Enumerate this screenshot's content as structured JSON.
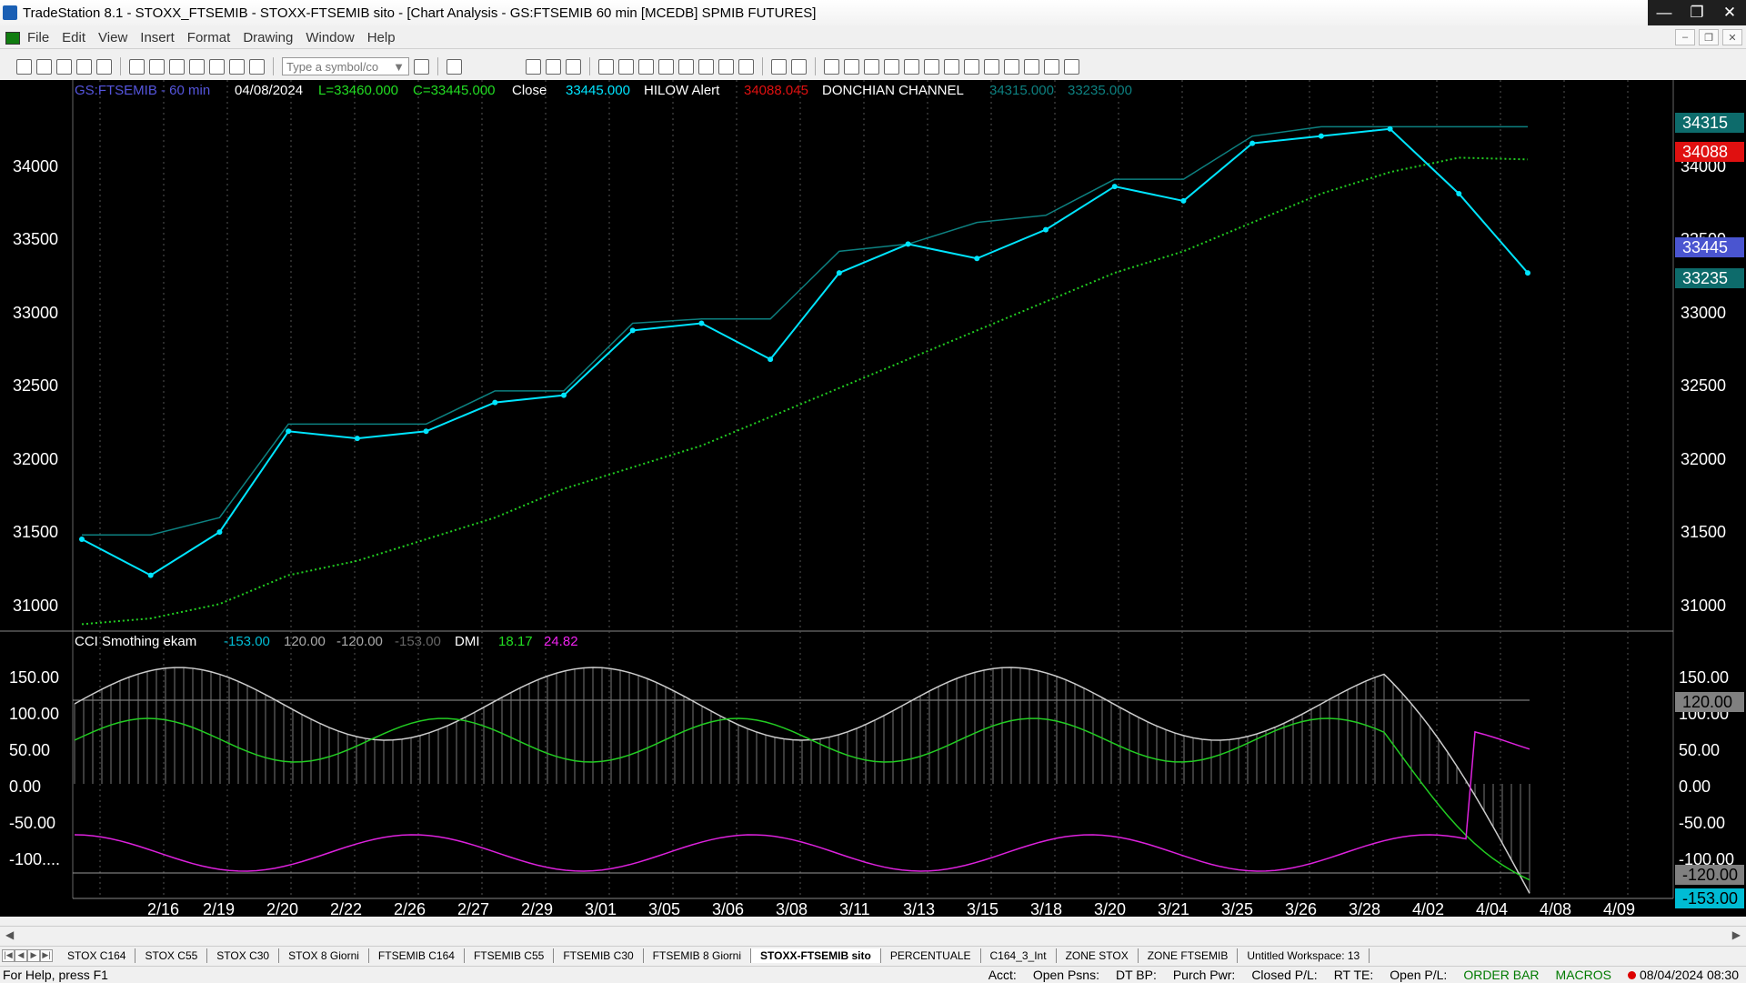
{
  "window": {
    "title": "TradeStation 8.1 - STOXX_FTSEMIB - STOXX-FTSEMIB sito - [Chart Analysis - GS:FTSEMIB  60 min  [MCEDB] SPMIB FUTURES]"
  },
  "menu": {
    "items": [
      "File",
      "Edit",
      "View",
      "Insert",
      "Format",
      "Drawing",
      "Window",
      "Help"
    ]
  },
  "toolbar": {
    "symbol_placeholder": "Type a symbol/co"
  },
  "chart": {
    "header": {
      "symbol": "GS:FTSEMIB - 60 min",
      "date": "04/08/2024",
      "low": "L=33460.000",
      "close_eq": "C=33445.000",
      "close_label": "Close",
      "close_value": "33445.000",
      "hilow_label": "HILOW Alert",
      "hilow_value": "34088.045",
      "donchian_label": "DONCHIAN CHANNEL",
      "donchian_upper": "34315.000",
      "donchian_lower": "33235.000"
    },
    "price_axis": [
      "34000",
      "33500",
      "33000",
      "32500",
      "32000",
      "31500",
      "31000"
    ],
    "price_tags": [
      {
        "value": "34315",
        "color": "#0d6b6b"
      },
      {
        "value": "34088",
        "color": "#e01010"
      },
      {
        "value": "33445",
        "color": "#4a55d0"
      },
      {
        "value": "33235",
        "color": "#0d6b6b"
      }
    ],
    "lower_header": {
      "name": "CCI Smothing ekam",
      "v1": "-153.00",
      "v2": "120.00",
      "v3": "-120.00",
      "v4": "-153.00",
      "dmi_label": "DMI",
      "dmi_plus": "18.17",
      "dmi_minus": "24.82"
    },
    "lower_axis": [
      "150.00",
      "100.00",
      "50.00",
      "0.00",
      "-50.00",
      "-100...."
    ],
    "lower_tags": [
      {
        "value": "120.00",
        "color": "#808080"
      },
      {
        "value": "-100.00",
        "color": "#000000"
      },
      {
        "value": "-120.00",
        "color": "#808080"
      },
      {
        "value": "-153.00",
        "color": "#00bcd4"
      }
    ],
    "date_axis": [
      "2/16",
      "2/19",
      "2/20",
      "2/22",
      "2/26",
      "2/27",
      "2/29",
      "3/01",
      "3/05",
      "3/06",
      "3/08",
      "3/11",
      "3/13",
      "3/15",
      "3/18",
      "3/20",
      "3/21",
      "3/25",
      "3/26",
      "3/28",
      "4/02",
      "4/04",
      "4/08",
      "4/09"
    ]
  },
  "chart_data": {
    "type": "line",
    "x": [
      "2/16",
      "2/19",
      "2/20",
      "2/22",
      "2/26",
      "2/27",
      "2/29",
      "3/01",
      "3/05",
      "3/06",
      "3/08",
      "3/11",
      "3/13",
      "3/15",
      "3/18",
      "3/20",
      "3/21",
      "3/25",
      "3/26",
      "3/28",
      "4/02",
      "4/04"
    ],
    "series": [
      {
        "name": "Close",
        "values": [
          31450,
          31200,
          31500,
          32200,
          32150,
          32200,
          32400,
          32450,
          32900,
          32950,
          32700,
          33300,
          33500,
          33400,
          33600,
          33900,
          33800,
          34200,
          34250,
          34300,
          33850,
          33300
        ]
      },
      {
        "name": "DONCHIAN CHANNEL",
        "values": [
          31480,
          31480,
          31600,
          32250,
          32250,
          32250,
          32480,
          32480,
          32950,
          32980,
          32980,
          33450,
          33500,
          33650,
          33700,
          33950,
          33950,
          34250,
          34315,
          34315,
          34315,
          34315
        ]
      },
      {
        "name": "HILOW Alert",
        "values": [
          30860,
          30900,
          31000,
          31200,
          31300,
          31450,
          31600,
          31800,
          31950,
          32100,
          32300,
          32500,
          32700,
          32900,
          33100,
          33300,
          33450,
          33650,
          33850,
          34000,
          34100,
          34088
        ]
      }
    ],
    "ylim": [
      30850,
      34450
    ]
  }
}
